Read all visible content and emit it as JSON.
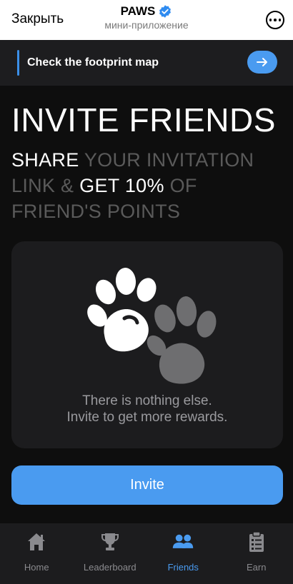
{
  "topbar": {
    "close_label": "Закрыть",
    "title": "PAWS",
    "subtitle": "мини-приложение",
    "verified_icon": "verified-badge-icon",
    "more_icon": "more-dots-icon"
  },
  "banner": {
    "text": "Check the footprint map",
    "arrow_icon": "arrow-right-icon"
  },
  "headline": "INVITE FRIENDS",
  "subhead": {
    "part1": "SHARE",
    "part2": " YOUR INVITATION LINK & ",
    "part3": "GET 10%",
    "part4": " OF FRIEND'S POINTS"
  },
  "empty_state": {
    "line1": "There is nothing else.",
    "line2": "Invite to get more rewards.",
    "illustration": "paw-prints-icon"
  },
  "invite_button": "Invite",
  "nav": {
    "items": [
      {
        "label": "Home",
        "icon": "home-icon"
      },
      {
        "label": "Leaderboard",
        "icon": "trophy-icon"
      },
      {
        "label": "Friends",
        "icon": "friends-icon",
        "active": true
      },
      {
        "label": "Earn",
        "icon": "clipboard-icon"
      }
    ]
  },
  "colors": {
    "accent": "#4a9bf0",
    "background": "#0e0e0e",
    "card": "#1c1c1e",
    "muted_text": "#5a5a5a"
  }
}
